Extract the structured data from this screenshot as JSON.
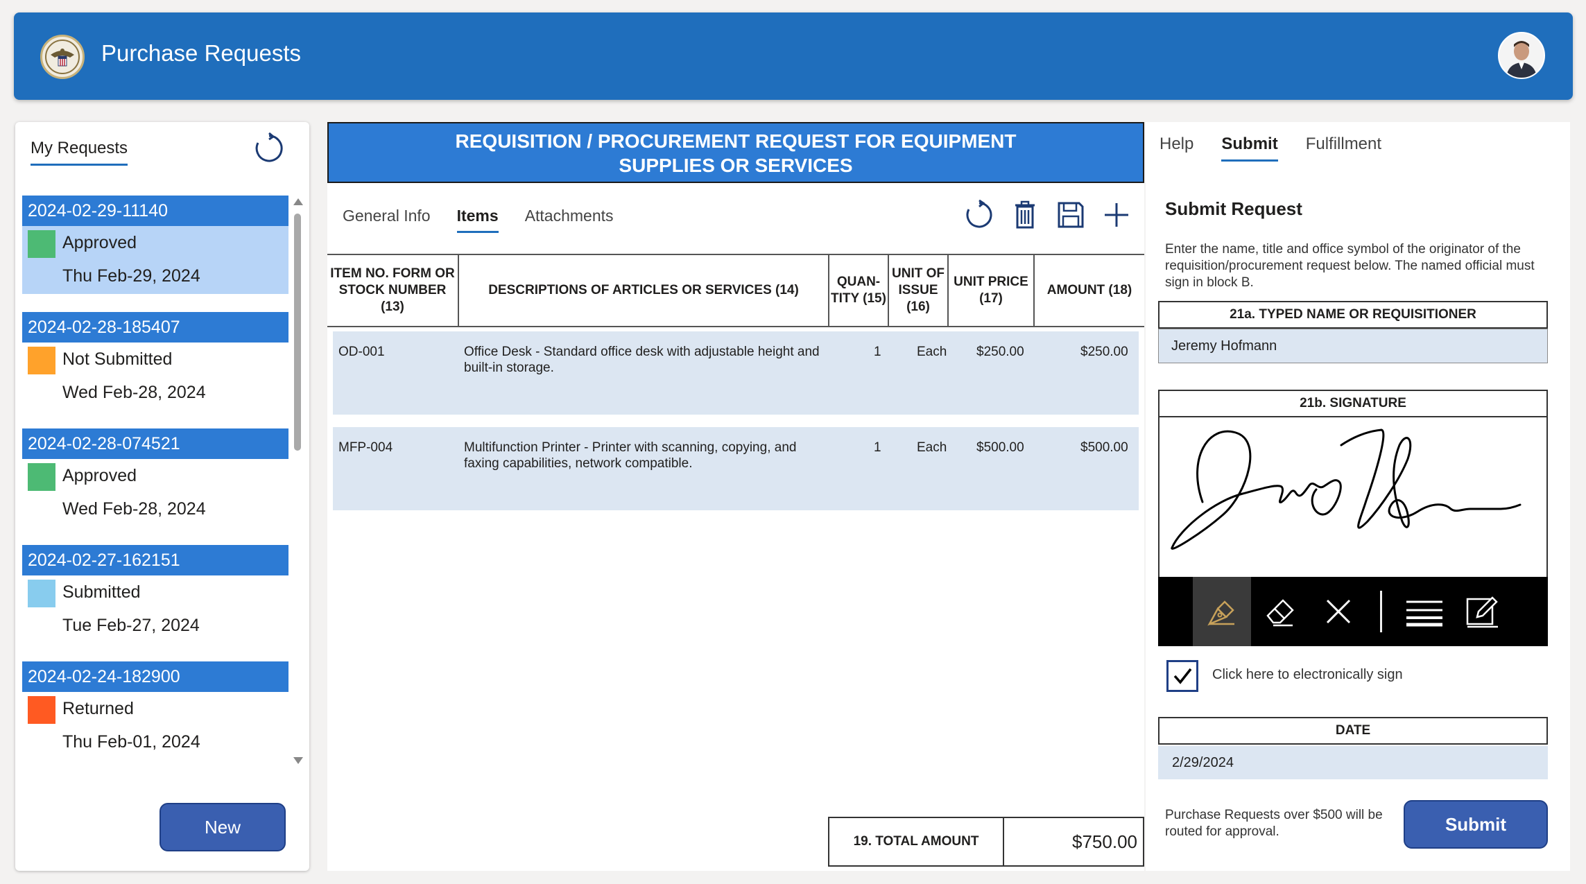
{
  "header": {
    "title": "Purchase Requests",
    "logo_icon": "seal-icon",
    "brand_color": "#1f6ebc"
  },
  "left": {
    "tab_label": "My Requests",
    "requests": [
      {
        "id": "2024-02-29-11140",
        "status": "Approved",
        "status_color": "#4dba74",
        "date": "Thu Feb-29, 2024",
        "selected": true
      },
      {
        "id": "2024-02-28-185407",
        "status": "Not Submitted",
        "status_color": "#ffa22b",
        "date": "Wed Feb-28, 2024"
      },
      {
        "id": "2024-02-28-074521",
        "status": "Approved",
        "status_color": "#4dba74",
        "date": "Wed Feb-28, 2024"
      },
      {
        "id": "2024-02-27-162151",
        "status": "Submitted",
        "status_color": "#88ccee",
        "date": "Tue Feb-27, 2024"
      },
      {
        "id": "2024-02-24-182900",
        "status": "Returned",
        "status_color": "#ff5a22",
        "date": "Thu Feb-01, 2024"
      }
    ],
    "new_label": "New"
  },
  "center": {
    "form_title_line1": "REQUISITION / PROCUREMENT REQUEST FOR EQUIPMENT",
    "form_title_line2": "SUPPLIES OR SERVICES",
    "tabs": [
      {
        "label": "General Info"
      },
      {
        "label": "Items",
        "active": true
      },
      {
        "label": "Attachments"
      }
    ],
    "toolbar_icons": [
      "refresh-icon",
      "trash-icon",
      "save-icon",
      "add-icon"
    ],
    "columns": {
      "item_no": "ITEM NO. FORM OR STOCK NUMBER (13)",
      "description": "DESCRIPTIONS OF ARTICLES OR SERVICES (14)",
      "quantity": "QUAN-TITY (15)",
      "unit_of_issue": "UNIT OF ISSUE (16)",
      "unit_price": "UNIT PRICE (17)",
      "amount": "AMOUNT (18)"
    },
    "items": [
      {
        "item_no": "OD-001",
        "description": "Office Desk - Standard office desk with adjustable height and built-in storage.",
        "quantity": "1",
        "unit": "Each",
        "unit_price": "$250.00",
        "amount": "$250.00"
      },
      {
        "item_no": "MFP-004",
        "description": "Multifunction Printer - Printer with scanning, copying, and faxing capabilities, network compatible.",
        "quantity": "1",
        "unit": "Each",
        "unit_price": "$500.00",
        "amount": "$500.00"
      }
    ],
    "total_label": "19. TOTAL AMOUNT",
    "total_value": "$750.00"
  },
  "right": {
    "tabs": [
      {
        "label": "Help"
      },
      {
        "label": "Submit",
        "active": true
      },
      {
        "label": "Fulfillment"
      }
    ],
    "heading": "Submit Request",
    "instructions": "Enter the name, title and office symbol of the originator of the requisition/procurement request below. The named official must sign in block B.",
    "name_label": "21a. TYPED NAME OR REQUISITIONER",
    "name_value": "Jeremy Hofmann",
    "signature_label": "21b. SIGNATURE",
    "signature_tools": [
      "pen-icon",
      "eraser-icon",
      "clear-icon",
      "line-weight-icon",
      "edit-icon"
    ],
    "sign_checked": true,
    "sign_label": "Click here to electronically sign",
    "date_label": "DATE",
    "date_value": "2/29/2024",
    "routing_note": "Purchase Requests over $500 will be routed for approval.",
    "submit_label": "Submit"
  }
}
